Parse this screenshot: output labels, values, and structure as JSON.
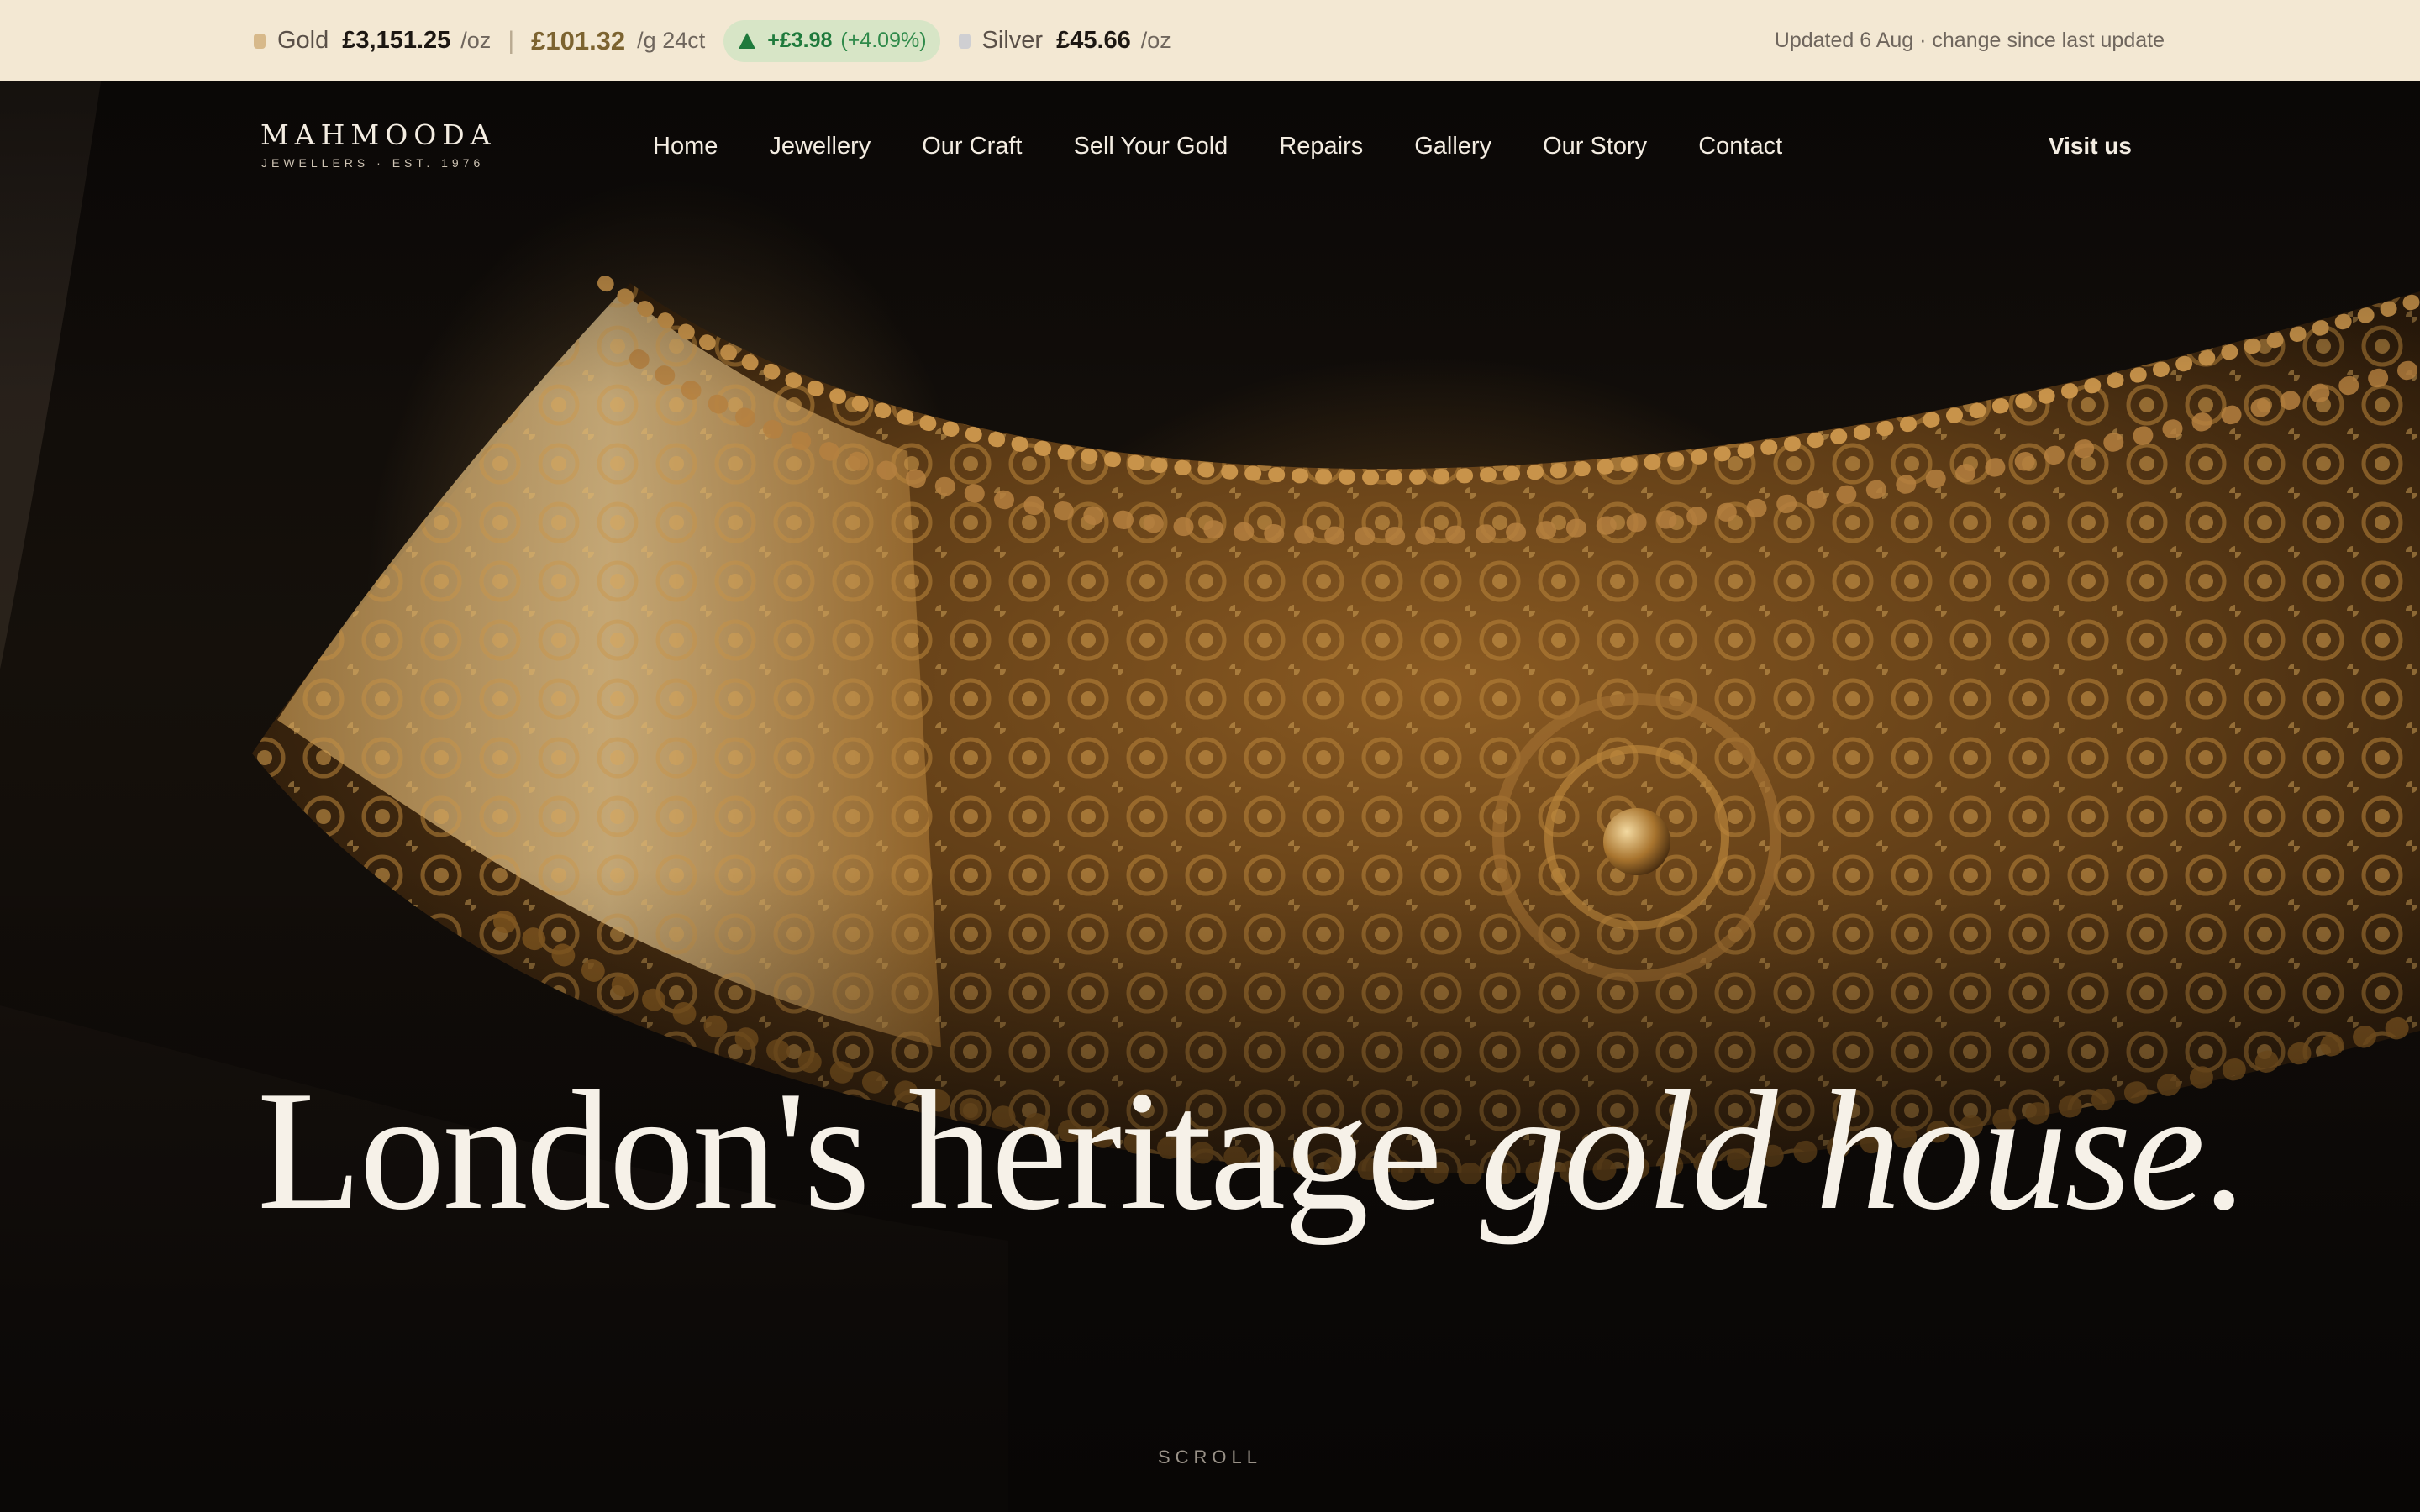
{
  "ticker": {
    "gold": {
      "label": "Gold",
      "price": "£3,151.25",
      "unit": "/oz",
      "gram_price": "£101.32",
      "gram_unit": "/g 24ct"
    },
    "change": {
      "absolute": "+£3.98",
      "percent": "(+4.09%)"
    },
    "silver": {
      "label": "Silver",
      "price": "£45.66",
      "unit": "/oz"
    },
    "updated": "Updated 6 Aug · change since last update"
  },
  "brand": {
    "name": "MAHMOODA",
    "tagline": "JEWELLERS · EST. 1976"
  },
  "nav": {
    "items": [
      {
        "label": "Home"
      },
      {
        "label": "Jewellery"
      },
      {
        "label": "Our Craft"
      },
      {
        "label": "Sell Your Gold"
      },
      {
        "label": "Repairs"
      },
      {
        "label": "Gallery"
      },
      {
        "label": "Our Story"
      },
      {
        "label": "Contact"
      }
    ],
    "cta": "Visit us"
  },
  "hero": {
    "headline_main": "London's heritage ",
    "headline_em": "gold house",
    "headline_end": ".",
    "scroll": "SCROLL"
  },
  "colors": {
    "ticker_bg": "#f3e8d3",
    "up_green": "#1f7a3c",
    "gold_accent": "#7c6330",
    "hero_text": "#f6f1e8"
  }
}
